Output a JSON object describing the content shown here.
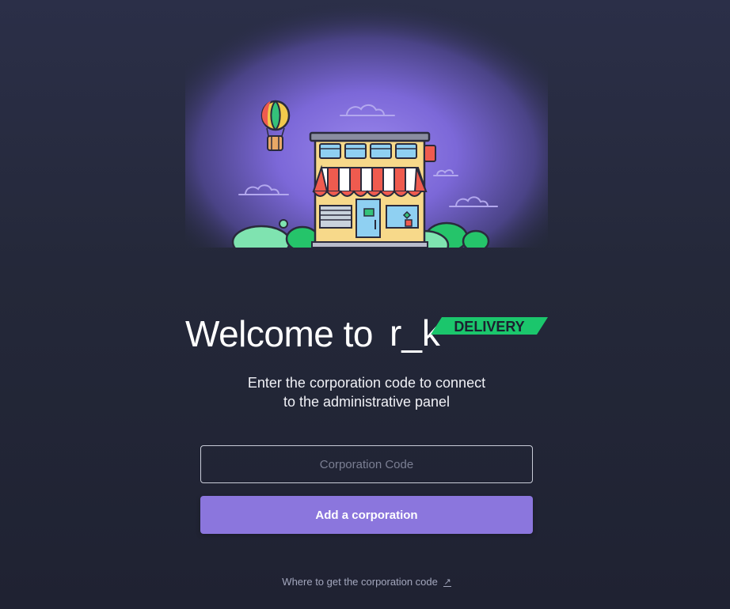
{
  "welcome": {
    "prefix": "Welcome to",
    "brand_main": "r_k",
    "brand_tag": "DELIVERY"
  },
  "subtitle": {
    "line1": "Enter the corporation code to connect",
    "line2": "to the administrative panel"
  },
  "form": {
    "code_placeholder": "Corporation Code",
    "code_value": "",
    "submit_label": "Add a corporation"
  },
  "help": {
    "link_label": "Where to get the corporation code",
    "link_icon": "external-link-icon"
  },
  "colors": {
    "accent": "#8b76dd",
    "brand_green": "#1bc66c",
    "background": "#242839"
  }
}
